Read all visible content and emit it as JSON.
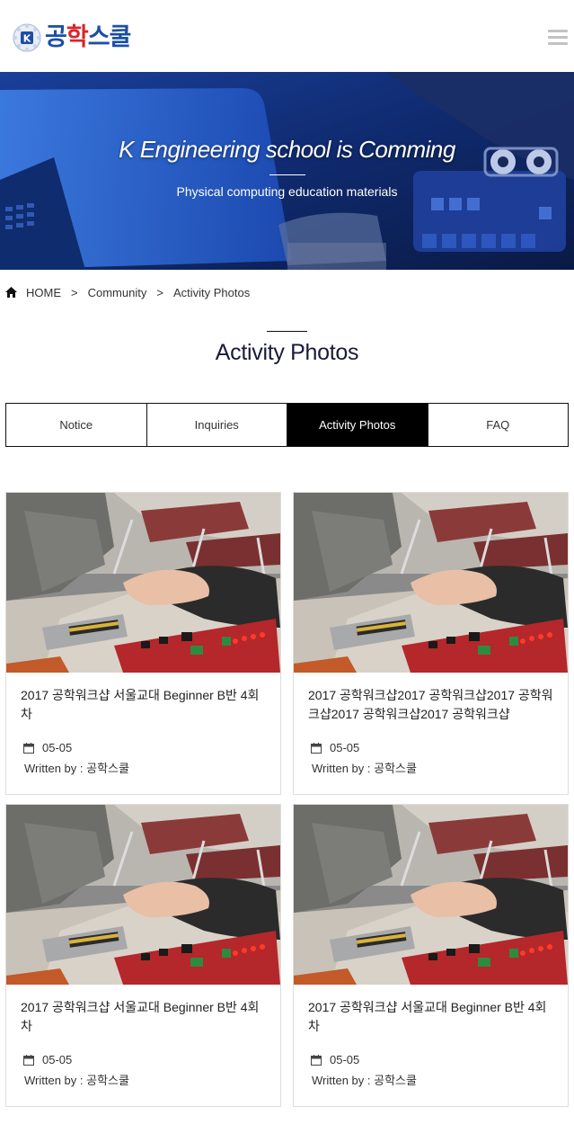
{
  "logo": {
    "text_part1": "공",
    "text_part2": "학",
    "text_part3": "스쿨",
    "emblem_letter": "K"
  },
  "hero": {
    "title": "K Engineering school is Comming",
    "subtitle": "Physical computing education materials"
  },
  "breadcrumb": {
    "home": "HOME",
    "separator": ">",
    "level1": "Community",
    "level2": "Activity Photos"
  },
  "page_title": "Activity Photos",
  "tabs": [
    {
      "label": "Notice",
      "active": false
    },
    {
      "label": "Inquiries",
      "active": false
    },
    {
      "label": "Activity Photos",
      "active": true
    },
    {
      "label": "FAQ",
      "active": false
    }
  ],
  "posts": [
    {
      "title": "2017 공학워크샵 서울교대 Beginner B반 4회차",
      "date": "05-05",
      "author": "Written by : 공학스쿨"
    },
    {
      "title": "2017 공학워크샵2017 공학워크샵2017 공학워크샵2017 공학워크샵2017 공학워크샵",
      "date": "05-05",
      "author": "Written by : 공학스쿨"
    },
    {
      "title": "2017 공학워크샵 서울교대 Beginner B반 4회차",
      "date": "05-05",
      "author": "Written by : 공학스쿨"
    },
    {
      "title": "2017 공학워크샵 서울교대 Beginner B반 4회차",
      "date": "05-05",
      "author": "Written by : 공학스쿨"
    }
  ],
  "colors": {
    "brand_blue": "#1c4ea6",
    "brand_red": "#d8262b",
    "tab_active_bg": "#000000",
    "hero_tint": "#0c2a78"
  },
  "icons": {
    "menu": "hamburger-icon",
    "home": "home-icon",
    "date": "calendar-icon"
  }
}
